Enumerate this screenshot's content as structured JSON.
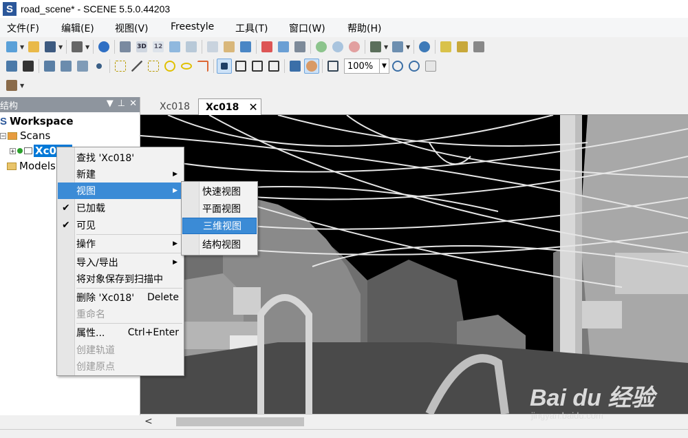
{
  "window": {
    "logo": "S",
    "title": "road_scene* - SCENE 5.5.0.44203"
  },
  "menubar": [
    {
      "label": "文件(F)"
    },
    {
      "label": "编辑(E)"
    },
    {
      "label": "视图(V)"
    },
    {
      "label": "Freestyle"
    },
    {
      "label": "工具(T)"
    },
    {
      "label": "窗口(W)"
    },
    {
      "label": "帮助(H)"
    }
  ],
  "toolbar": {
    "zoom_value": "100%",
    "three_d_label": "3D",
    "twelve_label": "12"
  },
  "structure_panel": {
    "title": "结构",
    "workspace_logo": "S",
    "workspace_label": "Workspace",
    "scans_label": "Scans",
    "scan_item_label": "Xc018",
    "models_label": "Models"
  },
  "tabs": [
    {
      "label": "Xc018"
    },
    {
      "label": "Xc018",
      "active": true
    }
  ],
  "context_menu": [
    {
      "label": "查找 'Xc018'"
    },
    {
      "label": "新建",
      "submenu": true
    },
    {
      "label": "视图",
      "submenu": true,
      "highlighted": true
    },
    {
      "label": "已加载",
      "checked": true
    },
    {
      "label": "可见",
      "checked": true
    },
    {
      "label": "操作",
      "submenu": true
    },
    {
      "label": "导入/导出",
      "submenu": true
    },
    {
      "label": "将对象保存到扫描中"
    },
    {
      "label": "删除 'Xc018'",
      "shortcut": "Delete"
    },
    {
      "label": "重命名",
      "disabled": true
    },
    {
      "label": "属性...",
      "shortcut": "Ctrl+Enter"
    },
    {
      "label": "创建轨道",
      "disabled": true
    },
    {
      "label": "创建原点",
      "disabled": true
    }
  ],
  "submenu": [
    {
      "label": "快速视图"
    },
    {
      "label": "平面视图"
    },
    {
      "label": "三维视图",
      "highlighted": true
    },
    {
      "label": "结构视图"
    }
  ],
  "watermark": {
    "logo": "Bai du 经验",
    "url": "jingyan.baidu.com"
  },
  "colors": {
    "accent": "#0078d7",
    "menu_highlight": "#3b8bd6",
    "panel_header": "#8e959e"
  }
}
